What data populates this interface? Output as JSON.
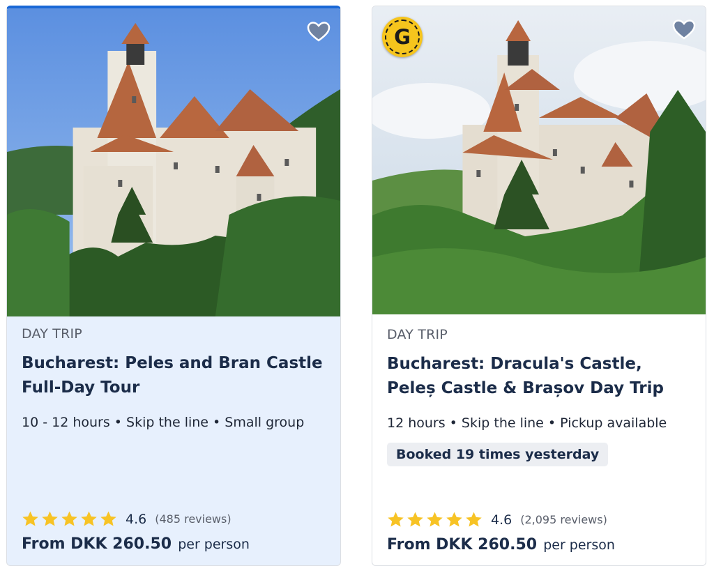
{
  "cards": [
    {
      "category": "DAY TRIP",
      "title": "Bucharest: Peles and Bran Castle Full-Day Tour",
      "meta": "10 - 12 hours • Skip the line • Small group",
      "rating": "4.6",
      "reviews": "(485 reviews)",
      "price": "From DKK 260.50",
      "price_unit": "per person",
      "image_alt": "Bran Castle on a rocky hill under blue sky",
      "stars": 5
    },
    {
      "category": "DAY TRIP",
      "title": "Bucharest: Dracula's Castle, Peleș Castle & Brașov Day Trip",
      "meta": "12 hours • Skip the line • Pickup available",
      "booked": "Booked 19 times yesterday",
      "badge": "G",
      "rating": "4.6",
      "reviews": "(2,095 reviews)",
      "price": "From DKK 260.50",
      "price_unit": "per person",
      "image_alt": "Bran Castle surrounded by green trees",
      "stars": 5
    }
  ],
  "colors": {
    "highlight_bg": "#e7f0fd",
    "highlight_border": "#1a68d6",
    "title": "#1b2c49",
    "star": "#f7c325",
    "badge": "#f6c51d"
  },
  "icons": {
    "wishlist": "heart-icon",
    "rating": "star-icon",
    "badge": "gyg-originals-badge"
  }
}
